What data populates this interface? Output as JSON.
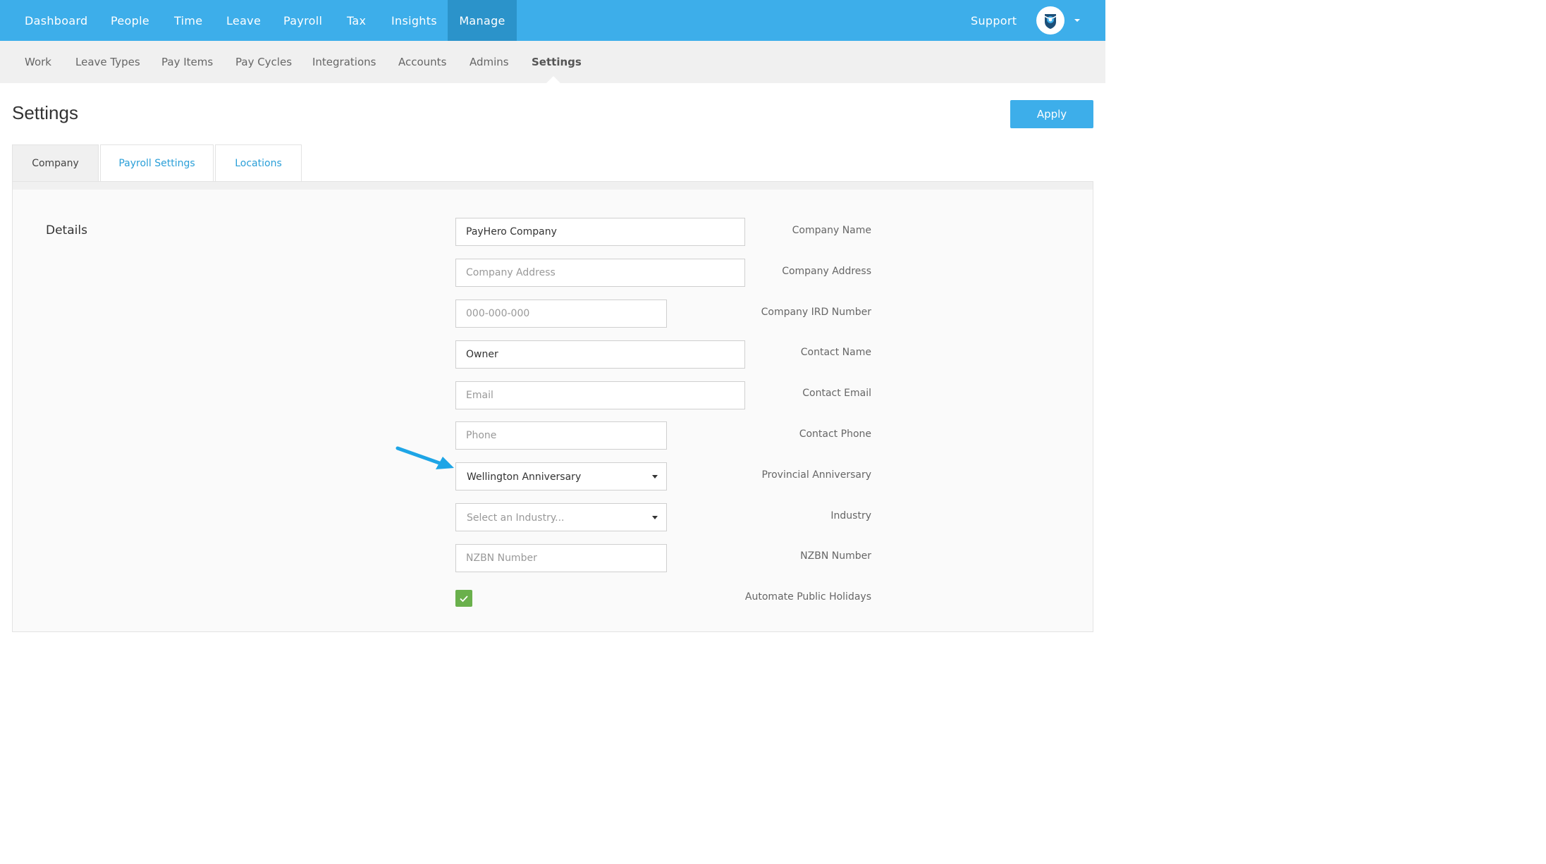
{
  "topnav": {
    "items": [
      "Dashboard",
      "People",
      "Time",
      "Leave",
      "Payroll",
      "Tax",
      "Insights",
      "Manage"
    ],
    "active": "Manage",
    "support": "Support",
    "accent_color": "#3daeea"
  },
  "subnav": {
    "items": [
      "Work",
      "Leave Types",
      "Pay Items",
      "Pay Cycles",
      "Integrations",
      "Accounts",
      "Admins",
      "Settings"
    ],
    "active": "Settings"
  },
  "page": {
    "title": "Settings",
    "apply_label": "Apply"
  },
  "tabs": [
    {
      "label": "Company",
      "active": true
    },
    {
      "label": "Payroll Settings",
      "active": false
    },
    {
      "label": "Locations",
      "active": false
    }
  ],
  "details": {
    "section_title": "Details",
    "company_name": {
      "label": "Company Name",
      "value": "PayHero Company",
      "placeholder": "Company Name"
    },
    "company_address": {
      "label": "Company Address",
      "value": "",
      "placeholder": "Company Address"
    },
    "company_ird": {
      "label": "Company IRD Number",
      "value": "",
      "placeholder": "000-000-000"
    },
    "contact_name": {
      "label": "Contact Name",
      "value": "Owner",
      "placeholder": "Contact Name"
    },
    "contact_email": {
      "label": "Contact Email",
      "value": "",
      "placeholder": "Email"
    },
    "contact_phone": {
      "label": "Contact Phone",
      "value": "",
      "placeholder": "Phone"
    },
    "provincial_anniversary": {
      "label": "Provincial Anniversary",
      "value": "Wellington Anniversary"
    },
    "industry": {
      "label": "Industry",
      "value": "Select an Industry..."
    },
    "nzbn": {
      "label": "NZBN Number",
      "value": "",
      "placeholder": "NZBN Number"
    },
    "automate_holidays": {
      "label": "Automate Public Holidays",
      "checked": true
    }
  },
  "icons": {
    "avatar": "shield-logo-icon",
    "caret": "chevron-down-icon",
    "checkbox": "check-icon",
    "annotation": "arrow-annotation-icon"
  }
}
